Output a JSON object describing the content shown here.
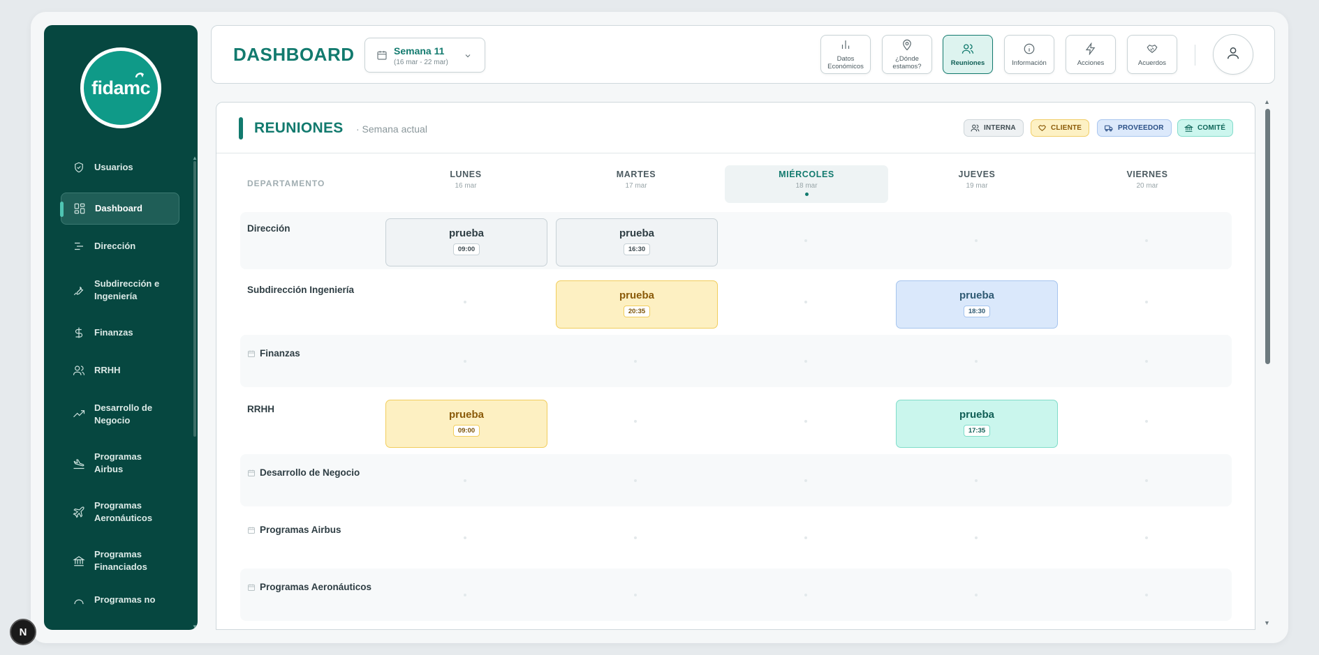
{
  "logo": {
    "text": "fidamc"
  },
  "sidebar": {
    "items": [
      {
        "label": "Usuarios",
        "icon": "shield-icon"
      },
      {
        "label": "Dashboard",
        "icon": "grid-icon",
        "active": true
      },
      {
        "label": "Dirección",
        "icon": "align-icon"
      },
      {
        "label": "Subdirección e Ingeniería",
        "icon": "wrench-icon"
      },
      {
        "label": "Finanzas",
        "icon": "dollar-icon"
      },
      {
        "label": "RRHH",
        "icon": "users-icon"
      },
      {
        "label": "Desarrollo de Negocio",
        "icon": "trending-up-icon"
      },
      {
        "label": "Programas Airbus",
        "icon": "plane-landing-icon"
      },
      {
        "label": "Programas Aeronáuticos",
        "icon": "plane-icon"
      },
      {
        "label": "Programas Financiados",
        "icon": "bank-icon"
      },
      {
        "label": "Programas no",
        "icon": "arc-icon"
      }
    ]
  },
  "header": {
    "title": "DASHBOARD",
    "week": {
      "title": "Semana 11",
      "range": "(16 mar - 22 mar)"
    },
    "buttons": [
      {
        "line1": "Datos",
        "line2": "Económicos",
        "icon": "bar-chart-icon"
      },
      {
        "line1": "¿Dónde",
        "line2": "estamos?",
        "icon": "map-pin-icon"
      },
      {
        "line1": "Reuniones",
        "line2": "",
        "icon": "users-icon",
        "active": true
      },
      {
        "line1": "Información",
        "line2": "",
        "icon": "info-icon"
      },
      {
        "line1": "Acciones",
        "line2": "",
        "icon": "zap-icon"
      },
      {
        "line1": "Acuerdos",
        "line2": "",
        "icon": "handshake-icon"
      }
    ]
  },
  "panel": {
    "title": "REUNIONES",
    "subtitle": "· Semana actual",
    "legend": {
      "interna": "INTERNA",
      "cliente": "CLIENTE",
      "proveedor": "PROVEEDOR",
      "comite": "COMITÉ"
    },
    "dept_header": "DEPARTAMENTO",
    "days": [
      {
        "name": "LUNES",
        "date": "16 mar"
      },
      {
        "name": "MARTES",
        "date": "17 mar"
      },
      {
        "name": "MIÉRCOLES",
        "date": "18 mar",
        "today": true
      },
      {
        "name": "JUEVES",
        "date": "19 mar"
      },
      {
        "name": "VIERNES",
        "date": "20 mar"
      }
    ],
    "rows": [
      {
        "label": "Dirección"
      },
      {
        "label": "Subdirección Ingeniería"
      },
      {
        "label": "Finanzas"
      },
      {
        "label": "RRHH"
      },
      {
        "label": "Desarrollo de Negocio"
      },
      {
        "label": "Programas Airbus"
      },
      {
        "label": "Programas Aeronáuticos"
      }
    ],
    "events": [
      {
        "title": "prueba",
        "time": "09:00",
        "type": "interna",
        "row": "Dirección",
        "day": "LUNES"
      },
      {
        "title": "prueba",
        "time": "16:30",
        "type": "interna",
        "row": "Dirección",
        "day": "MARTES"
      },
      {
        "title": "prueba",
        "time": "20:35",
        "type": "cliente",
        "row": "Subdirección Ingeniería",
        "day": "MARTES"
      },
      {
        "title": "prueba",
        "time": "18:30",
        "type": "proveedor",
        "row": "Subdirección Ingeniería",
        "day": "JUEVES"
      },
      {
        "title": "prueba",
        "time": "09:00",
        "type": "cliente",
        "row": "RRHH",
        "day": "LUNES"
      },
      {
        "title": "prueba",
        "time": "17:35",
        "type": "comite",
        "row": "RRHH",
        "day": "JUEVES"
      }
    ]
  },
  "badge": {
    "text": "N"
  }
}
